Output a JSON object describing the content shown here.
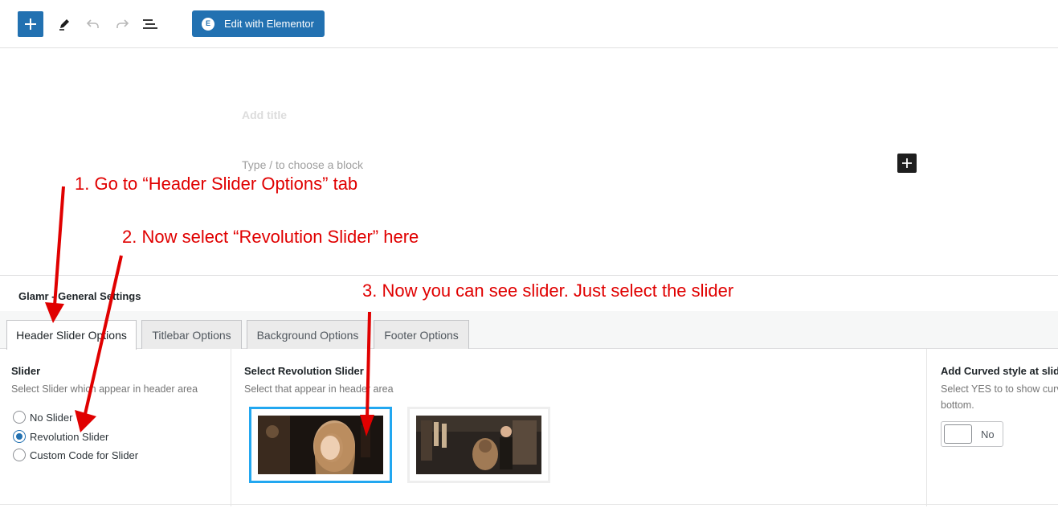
{
  "toolbar": {
    "add_block_icon": "plus-icon",
    "tools_icon": "pencil-icon",
    "undo_icon": "undo-icon",
    "redo_icon": "redo-icon",
    "outline_icon": "list-view-icon",
    "elementor_button_label": "Edit with Elementor",
    "accent_color": "#2271b1"
  },
  "editor": {
    "title_placeholder": "Add title",
    "block_placeholder": "Type / to choose a block"
  },
  "metabox": {
    "title": "Glamr - General Settings",
    "tabs": [
      {
        "label": "Header Slider Options",
        "active": true
      },
      {
        "label": "Titlebar Options",
        "active": false
      },
      {
        "label": "Background Options",
        "active": false
      },
      {
        "label": "Footer Options",
        "active": false
      }
    ],
    "slider": {
      "label": "Slider",
      "description": "Select Slider which appear in header area",
      "options": [
        {
          "label": "No Slider",
          "checked": false
        },
        {
          "label": "Revolution Slider",
          "checked": true
        },
        {
          "label": "Custom Code for Slider",
          "checked": false
        }
      ]
    },
    "revolution": {
      "label": "Select Revolution Slider",
      "description": "Select that appear in header area",
      "thumbnails": [
        {
          "name": "slider-thumb-1",
          "selected": true
        },
        {
          "name": "slider-thumb-2",
          "selected": false
        }
      ],
      "selected_border_color": "#22a7f0"
    },
    "curved": {
      "label": "Add Curved style at slide",
      "description_line1": "Select YES to to show curv",
      "description_line2": "bottom.",
      "toggle_label": "No",
      "toggle_on": false
    }
  },
  "annotations": {
    "step1": "1. Go to “Header Slider Options” tab",
    "step2": "2. Now select “Revolution Slider” here",
    "step3": "3. Now you can see slider. Just select the slider",
    "color": "#e00000"
  }
}
